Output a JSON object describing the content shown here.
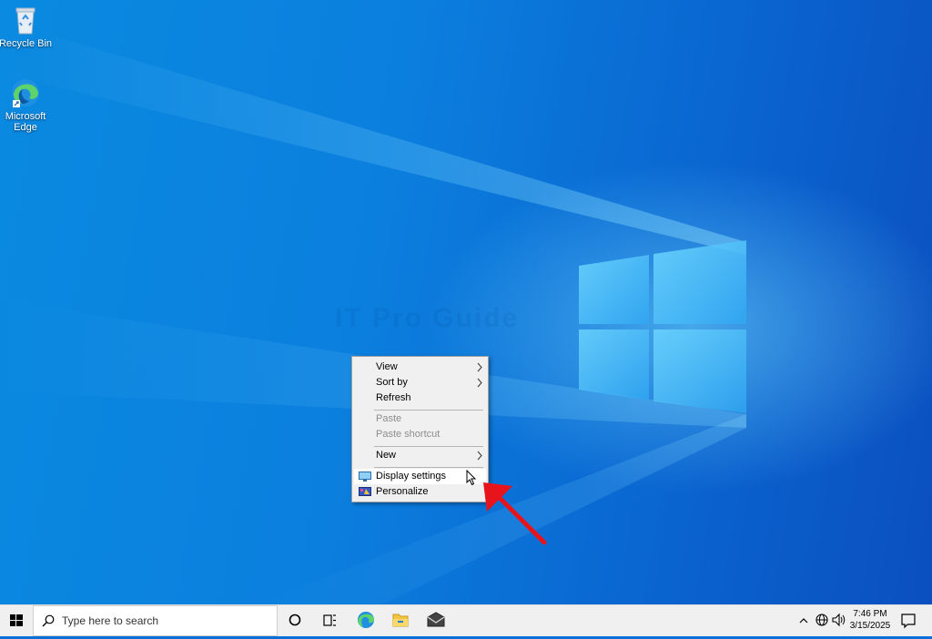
{
  "desktop": {
    "icons": [
      {
        "label": "Recycle Bin",
        "icon": "recycle-bin-icon"
      },
      {
        "label": "Microsoft\nEdge",
        "line1": "Microsoft",
        "line2": "Edge",
        "icon": "edge-icon"
      }
    ],
    "watermark": "IT Pro Guide"
  },
  "context_menu": {
    "items": [
      {
        "label": "View",
        "submenu": true,
        "enabled": true
      },
      {
        "label": "Sort by",
        "submenu": true,
        "enabled": true
      },
      {
        "label": "Refresh",
        "submenu": false,
        "enabled": true
      },
      {
        "label": "Paste",
        "submenu": false,
        "enabled": false
      },
      {
        "label": "Paste shortcut",
        "submenu": false,
        "enabled": false
      },
      {
        "label": "New",
        "submenu": true,
        "enabled": true
      },
      {
        "label": "Display settings",
        "submenu": false,
        "enabled": true,
        "highlighted": true,
        "icon": "display-icon"
      },
      {
        "label": "Personalize",
        "submenu": false,
        "enabled": true,
        "icon": "personalize-icon"
      }
    ],
    "submenu_glyph": ">"
  },
  "taskbar": {
    "search_placeholder": "Type here to search",
    "pinned": [
      "cortana-icon",
      "task-view-icon",
      "edge-icon",
      "file-explorer-icon",
      "mail-icon"
    ],
    "tray_icons": [
      "chevron-up-icon",
      "network-icon",
      "volume-icon"
    ],
    "time": "7:46 PM",
    "date": "3/15/2025"
  },
  "colors": {
    "desktop_blue": "#0a6fd8",
    "menu_bg": "#f0f0f0",
    "annotation_arrow": "#e8141c"
  }
}
